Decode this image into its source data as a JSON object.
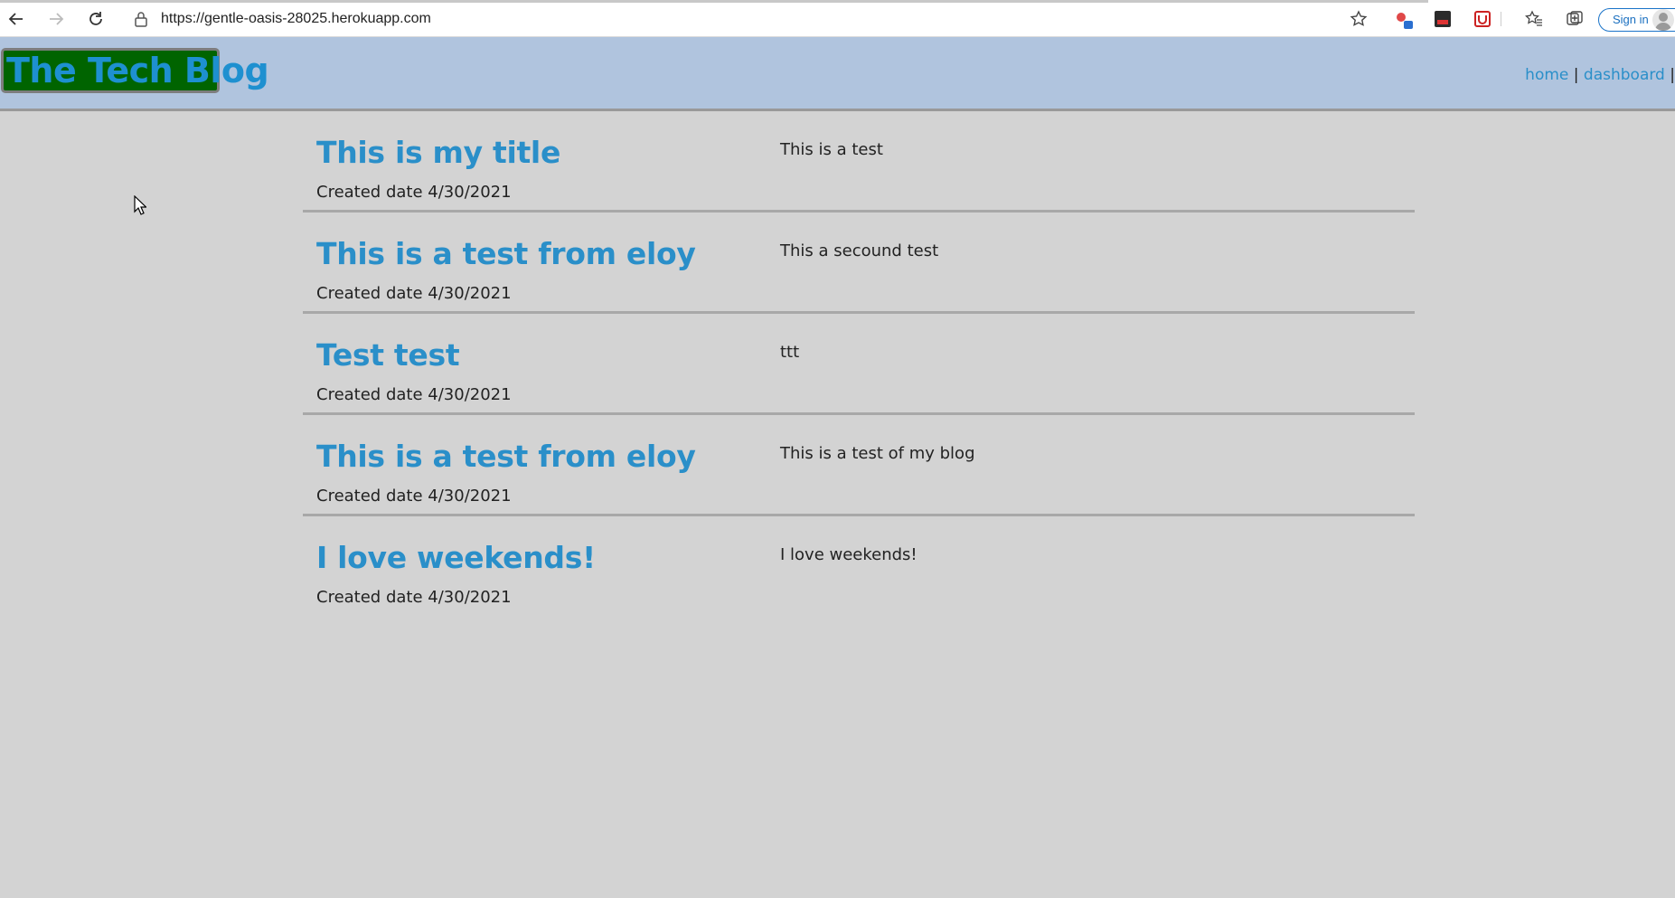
{
  "browser": {
    "url": "https://gentle-oasis-28025.herokuapp.com",
    "sign_in_label": "Sign in",
    "icons": [
      "back-icon",
      "forward-icon",
      "reload-icon",
      "lock-icon",
      "favorites-add-icon",
      "extension-icon",
      "extension-icon",
      "extension-icon",
      "favorites-icon",
      "collections-icon",
      "profile-avatar"
    ]
  },
  "header": {
    "logo": "The Tech Blog",
    "nav": {
      "home": "home",
      "separator": "|",
      "dashboard": "dashboard"
    }
  },
  "posts": [
    {
      "title": "This is my title",
      "date": "Created date 4/30/2021",
      "body": "This is a test"
    },
    {
      "title": "This is a test from eloy",
      "date": "Created date 4/30/2021",
      "body": "This a secound test"
    },
    {
      "title": "Test test",
      "date": "Created date 4/30/2021",
      "body": "ttt"
    },
    {
      "title": "This is a test from eloy",
      "date": "Created date 4/30/2021",
      "body": "This is a test of my blog"
    },
    {
      "title": "I love weekends!",
      "date": "Created date 4/30/2021",
      "body": "I love weekends!"
    }
  ],
  "colors": {
    "page_bg": "#d3d3d3",
    "header_bg": "#b0c4de",
    "logo_bg": "#006400",
    "link": "#2a8fc9"
  }
}
